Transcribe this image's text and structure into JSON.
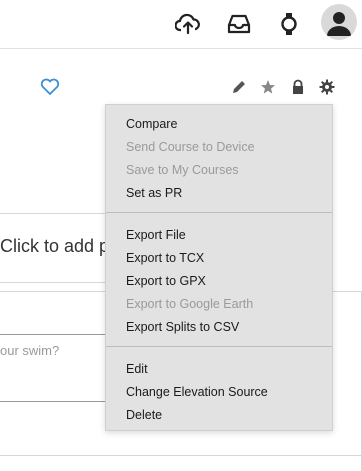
{
  "header": {
    "icons": [
      "upload-cloud-icon",
      "inbox-icon",
      "watch-icon",
      "user-avatar"
    ]
  },
  "activity": {
    "photo_prompt": "Click to add ph",
    "description_placeholder": "our swim?"
  },
  "menu": {
    "group1": [
      {
        "label": "Compare",
        "enabled": true
      },
      {
        "label": "Send Course to Device",
        "enabled": false
      },
      {
        "label": "Save to My Courses",
        "enabled": false
      },
      {
        "label": "Set as PR",
        "enabled": true
      }
    ],
    "group2": [
      {
        "label": "Export File",
        "enabled": true
      },
      {
        "label": "Export to TCX",
        "enabled": true
      },
      {
        "label": "Export to GPX",
        "enabled": true
      },
      {
        "label": "Export to Google Earth",
        "enabled": false
      },
      {
        "label": "Export Splits to CSV",
        "enabled": true
      }
    ],
    "group3": [
      {
        "label": "Edit",
        "enabled": true
      },
      {
        "label": "Change Elevation Source",
        "enabled": true
      },
      {
        "label": "Delete",
        "enabled": true
      }
    ]
  },
  "colors": {
    "accent": "#3b8ed8",
    "menu_bg": "#e2e2e2",
    "disabled_text": "#9a9a9a"
  }
}
